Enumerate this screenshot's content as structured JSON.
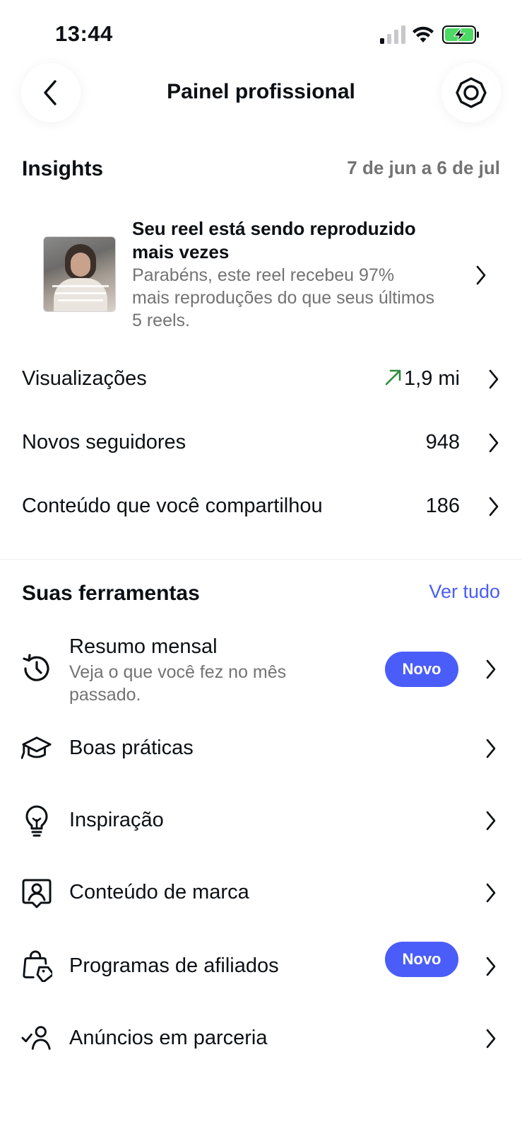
{
  "status_bar": {
    "time": "13:44"
  },
  "header": {
    "title": "Painel profissional"
  },
  "insights": {
    "title": "Insights",
    "date_range": "7 de jun a 6 de jul",
    "highlight": {
      "title": "Seu reel está sendo reproduzido mais vezes",
      "description": "Parabéns, este reel recebeu 97% mais reproduções do que seus últimos 5 reels."
    },
    "metrics": [
      {
        "label": "Visualizações",
        "value": "1,9 mi",
        "trend": "up"
      },
      {
        "label": "Novos seguidores",
        "value": "948"
      },
      {
        "label": "Conteúdo que você compartilhou",
        "value": "186"
      }
    ]
  },
  "tools": {
    "title": "Suas ferramentas",
    "see_all": "Ver tudo",
    "items": [
      {
        "label": "Resumo mensal",
        "subtitle": "Veja o que você fez no mês passado.",
        "badge": "Novo",
        "icon": "history-icon"
      },
      {
        "label": "Boas práticas",
        "icon": "graduation-cap-icon"
      },
      {
        "label": "Inspiração",
        "icon": "lightbulb-icon"
      },
      {
        "label": "Conteúdo de marca",
        "icon": "branded-content-icon"
      },
      {
        "label": "Programas de afiliados",
        "badge": "Novo",
        "icon": "shopping-bag-tag-icon"
      },
      {
        "label": "Anúncios em parceria",
        "icon": "partnership-ads-icon"
      }
    ]
  },
  "colors": {
    "accent": "#4a5df9",
    "trend_up": "#2e8b3e",
    "secondary_text": "#737373",
    "battery_green": "#4cd964"
  }
}
